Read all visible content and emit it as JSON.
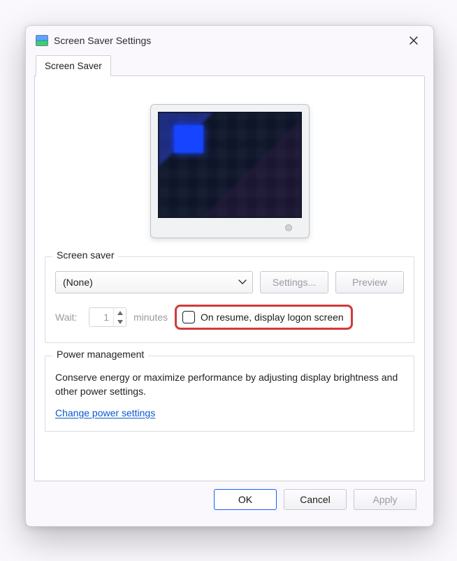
{
  "window": {
    "title": "Screen Saver Settings"
  },
  "tabs": [
    {
      "label": "Screen Saver"
    }
  ],
  "screensaver": {
    "legend": "Screen saver",
    "selected": "(None)",
    "settings_btn": "Settings...",
    "preview_btn": "Preview",
    "wait_label": "Wait:",
    "wait_value": "1",
    "wait_unit": "minutes",
    "resume_label": "On resume, display logon screen"
  },
  "power": {
    "legend": "Power management",
    "text": "Conserve energy or maximize performance by adjusting display brightness and other power settings.",
    "link": "Change power settings"
  },
  "footer": {
    "ok": "OK",
    "cancel": "Cancel",
    "apply": "Apply"
  }
}
